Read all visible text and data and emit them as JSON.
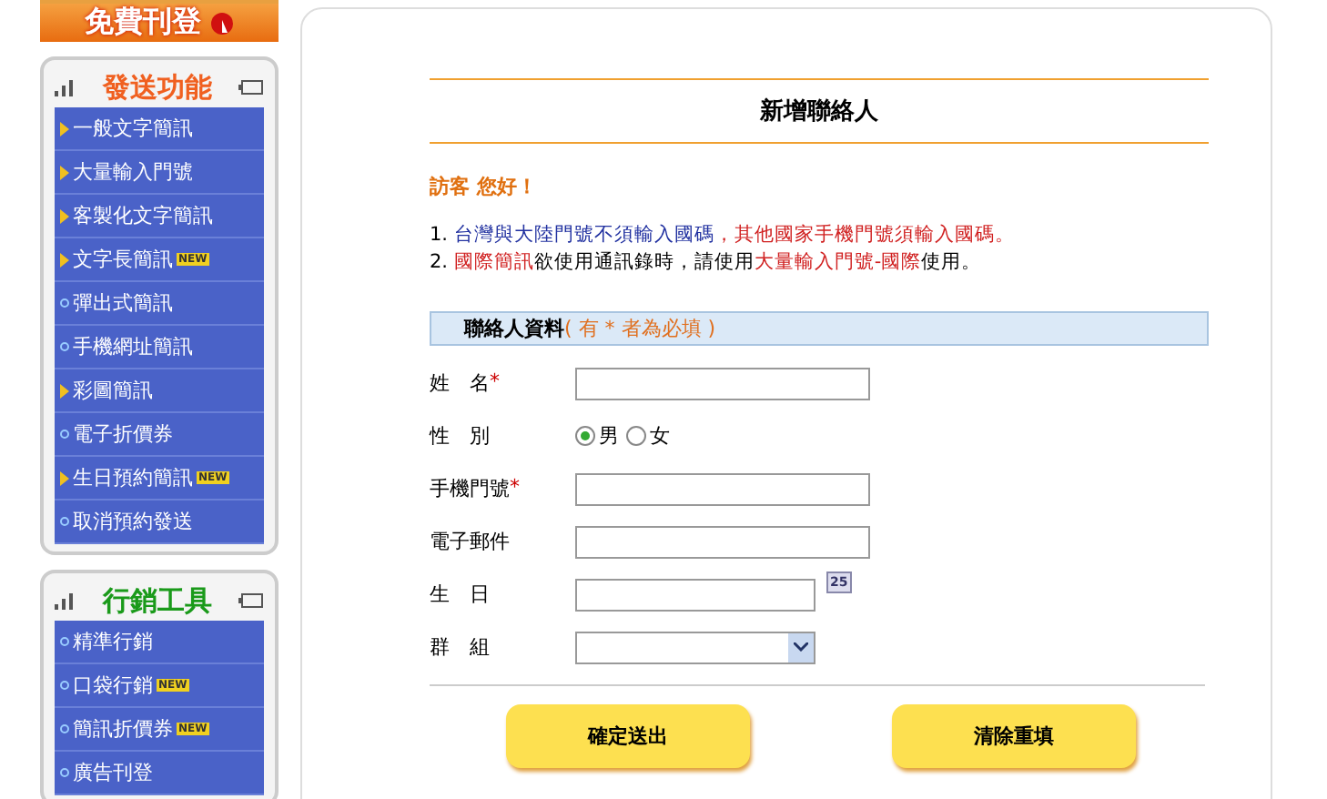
{
  "banner": {
    "label": "免費刊登"
  },
  "sidebar_panels": [
    {
      "title": "發送功能",
      "color": "#f06020",
      "items": [
        {
          "label": "一般文字簡訊",
          "kind": "arrow"
        },
        {
          "label": "大量輸入門號",
          "kind": "arrow"
        },
        {
          "label": "客製化文字簡訊",
          "kind": "arrow"
        },
        {
          "label": "文字長簡訊",
          "kind": "arrow",
          "badge": "NEW"
        },
        {
          "label": "彈出式簡訊",
          "kind": "dot"
        },
        {
          "label": "手機網址簡訊",
          "kind": "dot"
        },
        {
          "label": "彩圖簡訊",
          "kind": "arrow"
        },
        {
          "label": "電子折價券",
          "kind": "dot"
        },
        {
          "label": "生日預約簡訊",
          "kind": "arrow",
          "badge": "NEW"
        },
        {
          "label": "取消預約發送",
          "kind": "dot"
        }
      ]
    },
    {
      "title": "行銷工具",
      "color": "#1a9a1a",
      "items": [
        {
          "label": "精準行銷",
          "kind": "dot"
        },
        {
          "label": "口袋行銷",
          "kind": "dot",
          "badge": "NEW"
        },
        {
          "label": "簡訊折價券",
          "kind": "dot",
          "badge": "NEW"
        },
        {
          "label": "廣告刊登",
          "kind": "dot"
        }
      ]
    }
  ],
  "form": {
    "title": "新增聯絡人",
    "greeting": "訪客 您好！",
    "notes": [
      [
        {
          "text": "1. ",
          "color": "#000000"
        },
        {
          "text": "台灣與大陸門號不須輸入國碼",
          "color": "#2030a0"
        },
        {
          "text": "，其他國家手機門號須輸入國碼。",
          "color": "#d02020"
        }
      ],
      [
        {
          "text": "2. ",
          "color": "#000000"
        },
        {
          "text": "國際簡訊",
          "color": "#d02020"
        },
        {
          "text": "欲使用通訊錄時，請使用",
          "color": "#000000"
        },
        {
          "text": "大量輸入門號-國際",
          "color": "#d02020"
        },
        {
          "text": "使用。",
          "color": "#000000"
        }
      ]
    ],
    "section": {
      "title": "聯絡人資料",
      "hint": "( 有 * 者為必填 )"
    },
    "fields": [
      {
        "label": "姓　名",
        "required_mark": "*",
        "kind": "text"
      },
      {
        "label": "性　別",
        "kind": "radio",
        "options": [
          {
            "label": "男",
            "selected": true
          },
          {
            "label": "女",
            "selected": false
          }
        ]
      },
      {
        "label": "手機門號",
        "required_mark": "*",
        "kind": "text"
      },
      {
        "label": "電子郵件",
        "kind": "text"
      },
      {
        "label": "生　日",
        "kind": "date",
        "icon_text": "25"
      },
      {
        "label": "群　組",
        "kind": "select"
      }
    ],
    "buttons": [
      "確定送出",
      "清除重填"
    ]
  }
}
